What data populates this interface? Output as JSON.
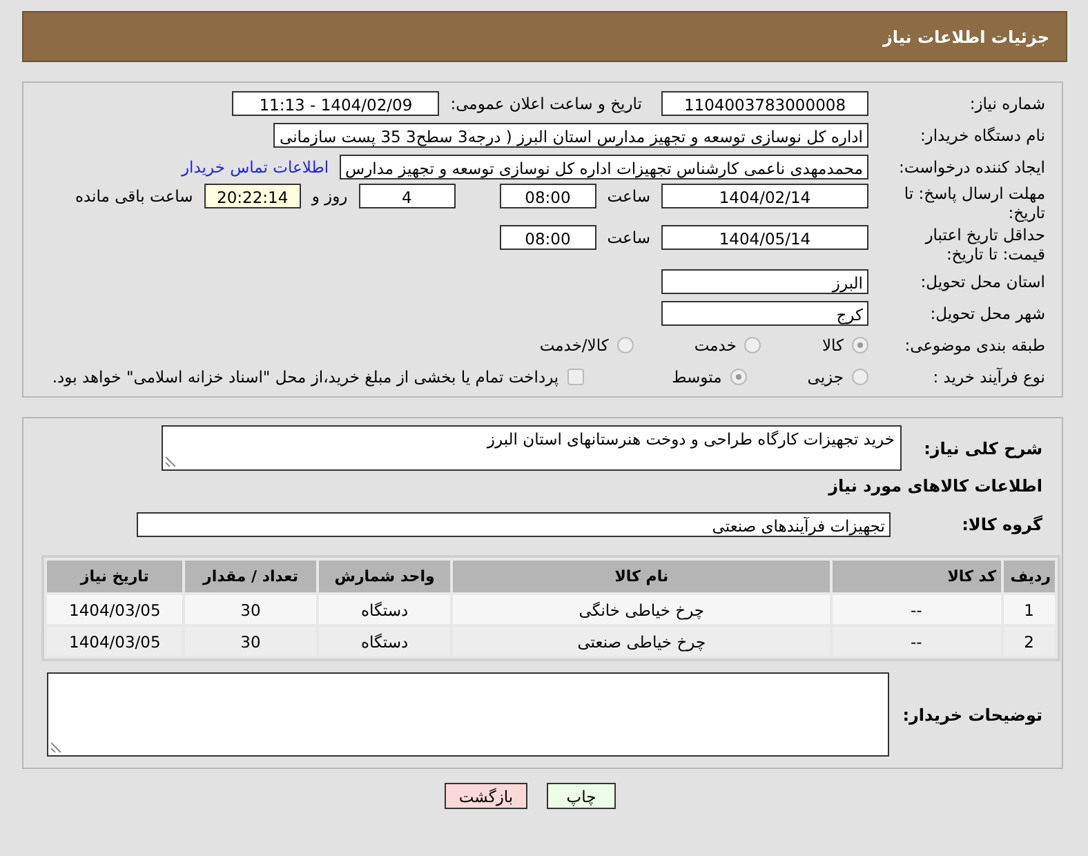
{
  "header": {
    "title": "جزئیات اطلاعات نیاز"
  },
  "need_number": {
    "label": "شماره نیاز:",
    "value": "1104003783000008"
  },
  "announce": {
    "label": "تاریخ و ساعت اعلان عمومی:",
    "value": "1404/02/09 - 11:13"
  },
  "buyer_org": {
    "label": "نام دستگاه خریدار:",
    "value": "اداره کل نوسازی   توسعه و تجهیز مدارس استان البرز ( درجه3  سطح3  35 پست سازمانی"
  },
  "requester": {
    "label": "ایجاد کننده درخواست:",
    "value": "محمدمهدی ناعمی کارشناس تجهیزات اداره کل نوسازی   توسعه و تجهیز مدارس",
    "link": "اطلاعات تماس خریدار"
  },
  "deadline": {
    "label": "مهلت ارسال پاسخ: تا تاریخ:",
    "date": "1404/02/14",
    "time_label": "ساعت",
    "time": "08:00",
    "days": "4",
    "days_label": "روز و",
    "remaining": "20:22:14",
    "remaining_label": "ساعت باقی مانده"
  },
  "price_validity": {
    "label": "حداقل تاریخ اعتبار قیمت: تا تاریخ:",
    "date": "1404/05/14",
    "time_label": "ساعت",
    "time": "08:00"
  },
  "province": {
    "label": "استان محل تحویل:",
    "value": "البرز"
  },
  "city": {
    "label": "شهر محل تحویل:",
    "value": "کرج"
  },
  "category": {
    "label": "طبقه بندی موضوعی:",
    "options": [
      {
        "label": "کالا",
        "selected": true
      },
      {
        "label": "خدمت",
        "selected": false
      },
      {
        "label": "کالا/خدمت",
        "selected": false
      }
    ]
  },
  "purchase_type": {
    "label": "نوع فرآیند خرید :",
    "options": [
      {
        "label": "جزیی",
        "selected": false
      },
      {
        "label": "متوسط",
        "selected": true
      }
    ],
    "payment": {
      "label": "پرداخت تمام یا بخشی از مبلغ خرید،از محل \"اسناد خزانه اسلامی\" خواهد بود.",
      "checked": false
    }
  },
  "description": {
    "label": "شرح کلی نیاز:",
    "value": "خرید تجهیزات کارگاه طراحی و دوخت هنرستانهای استان البرز"
  },
  "goods_heading": "اطلاعات کالاهای مورد نیاز",
  "goods_group": {
    "label": "گروه کالا:",
    "value": "تجهیزات فرآیندهای صنعتی"
  },
  "table": {
    "columns": [
      "ردیف",
      "کد کالا",
      "نام کالا",
      "واحد شمارش",
      "تعداد / مقدار",
      "تاریخ نیاز"
    ],
    "rows": [
      [
        "1",
        "--",
        "چرخ خیاطی خانگی",
        "دستگاه",
        "30",
        "1404/03/05"
      ],
      [
        "2",
        "--",
        "چرخ خیاطی صنعتی",
        "دستگاه",
        "30",
        "1404/03/05"
      ]
    ]
  },
  "buyer_notes": {
    "label": "توضیحات خریدار:"
  },
  "buttons": [
    {
      "label": "چاپ",
      "kind": "print"
    },
    {
      "label": "بازگشت",
      "kind": "back"
    }
  ]
}
